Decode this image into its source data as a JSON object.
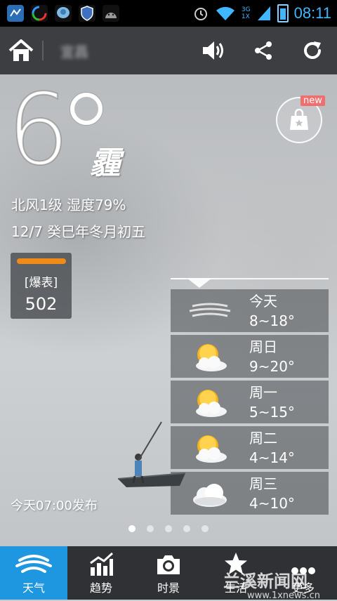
{
  "status_bar": {
    "time": "08:11",
    "network": "3G",
    "network2": "1X",
    "icons": [
      "app-icon-1",
      "app-icon-2",
      "app-icon-3",
      "shield-icon",
      "android-icon",
      "alarm-icon",
      "wifi-icon",
      "signal-icon",
      "battery-icon"
    ]
  },
  "header": {
    "city": "宜昌",
    "actions": [
      "volume-icon",
      "share-icon",
      "refresh-icon"
    ]
  },
  "current": {
    "temperature": "6",
    "condition": "霾",
    "wind_humidity": "北风1级 湿度79%",
    "date": "12/7 癸巳年冬月初五",
    "badge_new": "new"
  },
  "aqi": {
    "label": "[爆表]",
    "value": "502",
    "bar_color": "#f08a19"
  },
  "forecast": [
    {
      "day": "今天",
      "range": "8~18°",
      "icon": "haze-icon"
    },
    {
      "day": "周日",
      "range": "9~20°",
      "icon": "partly-cloudy-icon"
    },
    {
      "day": "周一",
      "range": "5~15°",
      "icon": "partly-cloudy-icon"
    },
    {
      "day": "周二",
      "range": "4~14°",
      "icon": "partly-cloudy-icon"
    },
    {
      "day": "周三",
      "range": "4~10°",
      "icon": "cloudy-icon"
    }
  ],
  "publish_time": "今天07:00发布",
  "pager": {
    "count": 5,
    "active": 1
  },
  "bottom_nav": [
    {
      "label": "天气",
      "icon": "weather-icon",
      "active": true
    },
    {
      "label": "趋势",
      "icon": "trend-icon",
      "active": false
    },
    {
      "label": "时景",
      "icon": "camera-icon",
      "active": false
    },
    {
      "label": "生活",
      "icon": "star-icon",
      "active": false
    },
    {
      "label": "更多",
      "icon": "more-icon",
      "active": false
    }
  ],
  "watermark": {
    "name": "兰溪新闻网",
    "url": "www.1xnews.cn"
  },
  "colors": {
    "accent": "#1e96e0",
    "header_bg": "#3c3e42",
    "nav_bg": "#2f3135",
    "time": "#3fb7ff",
    "new_tag": "#ef6f6f"
  }
}
